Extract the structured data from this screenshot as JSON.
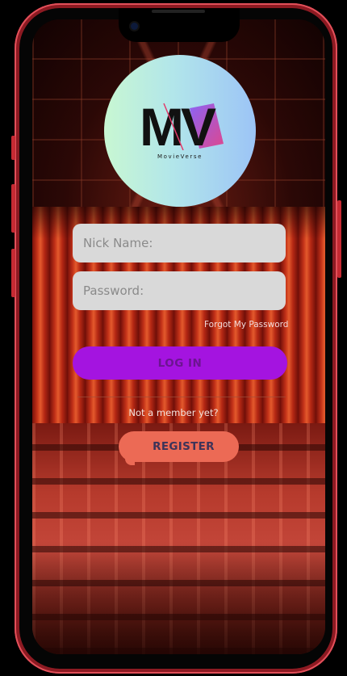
{
  "app": {
    "logo_letters": "MV",
    "logo_subtitle": "MovieVerse"
  },
  "form": {
    "nickname_placeholder": "Nick Name:",
    "password_placeholder": "Password:",
    "forgot_password": "Forgot My  Password",
    "login_label": "LOG IN",
    "not_member": "Not a member yet?",
    "register_label": "REGISTER"
  },
  "colors": {
    "frame": "#c62a33",
    "login_button": "#a414e0",
    "register_button": "#ec6a55",
    "field_bg": "#d9d9d9"
  }
}
